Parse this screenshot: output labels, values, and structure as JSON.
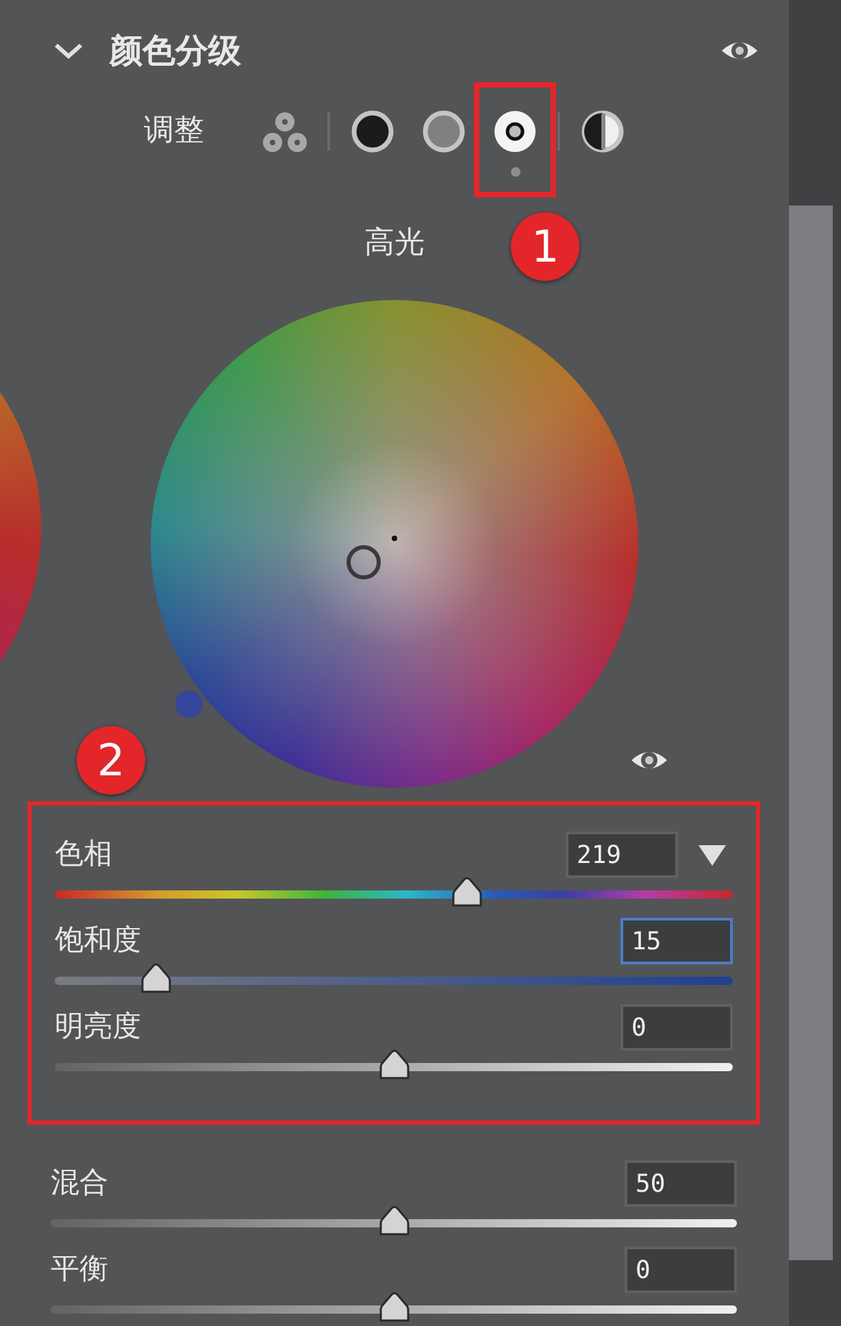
{
  "panel": {
    "title": "颜色分级",
    "expanded": true
  },
  "adjust": {
    "label": "调整",
    "callout": "1",
    "modes": [
      {
        "kind": "all",
        "selected": false
      },
      {
        "kind": "shadows",
        "selected": false
      },
      {
        "kind": "midtones",
        "selected": false
      },
      {
        "kind": "highlights",
        "selected": true
      },
      {
        "kind": "global",
        "selected": false
      }
    ]
  },
  "wheel": {
    "title": "高光"
  },
  "slider_groups": [
    {
      "callout": "2",
      "sliders": [
        {
          "kind": "hue",
          "label": "色相",
          "value": "219",
          "level": 0.608,
          "focused": false
        },
        {
          "kind": "saturation",
          "label": "饱和度",
          "value": "15",
          "level": 0.15,
          "focused": true
        },
        {
          "kind": "plain",
          "label": "明亮度",
          "value": "0",
          "level": 0.5,
          "focused": false
        }
      ]
    },
    {
      "sliders": [
        {
          "kind": "plain",
          "label": "混合",
          "value": "50",
          "level": 0.5,
          "focused": false
        },
        {
          "kind": "plain",
          "label": "平衡",
          "value": "0",
          "level": 0.5,
          "focused": false
        }
      ]
    }
  ]
}
